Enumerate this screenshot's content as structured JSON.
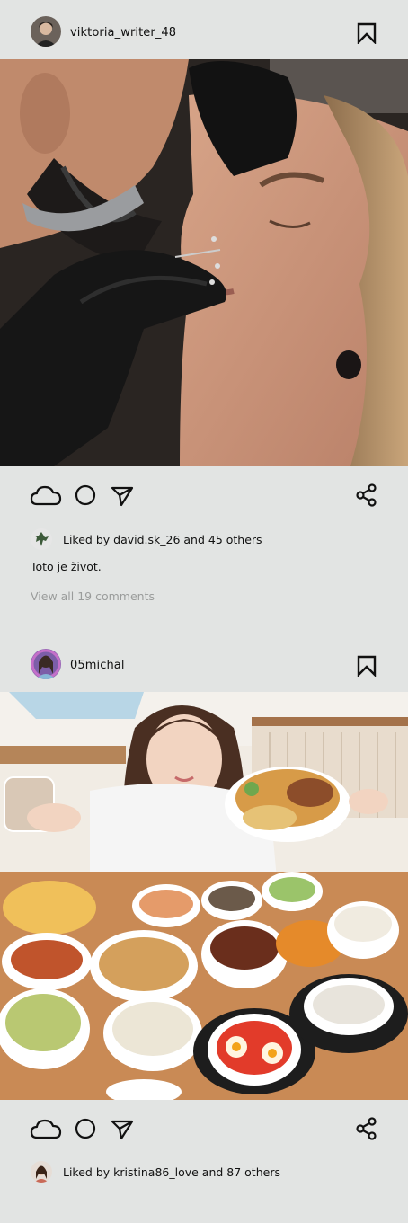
{
  "posts": [
    {
      "username": "viktoria_writer_48",
      "liked_by": "Liked by david.sk_26 and 45 others",
      "caption": "Toto je život.",
      "comments_link": "View all 19 comments",
      "image_description": "piercing"
    },
    {
      "username": "05michal",
      "liked_by": "Liked by kristina86_love and 87 others",
      "image_description": "food"
    }
  ],
  "icons": {
    "like": "cloud-icon",
    "comment": "circle-icon",
    "send": "send-icon",
    "share": "share-icon",
    "bookmark": "bookmark-icon"
  }
}
